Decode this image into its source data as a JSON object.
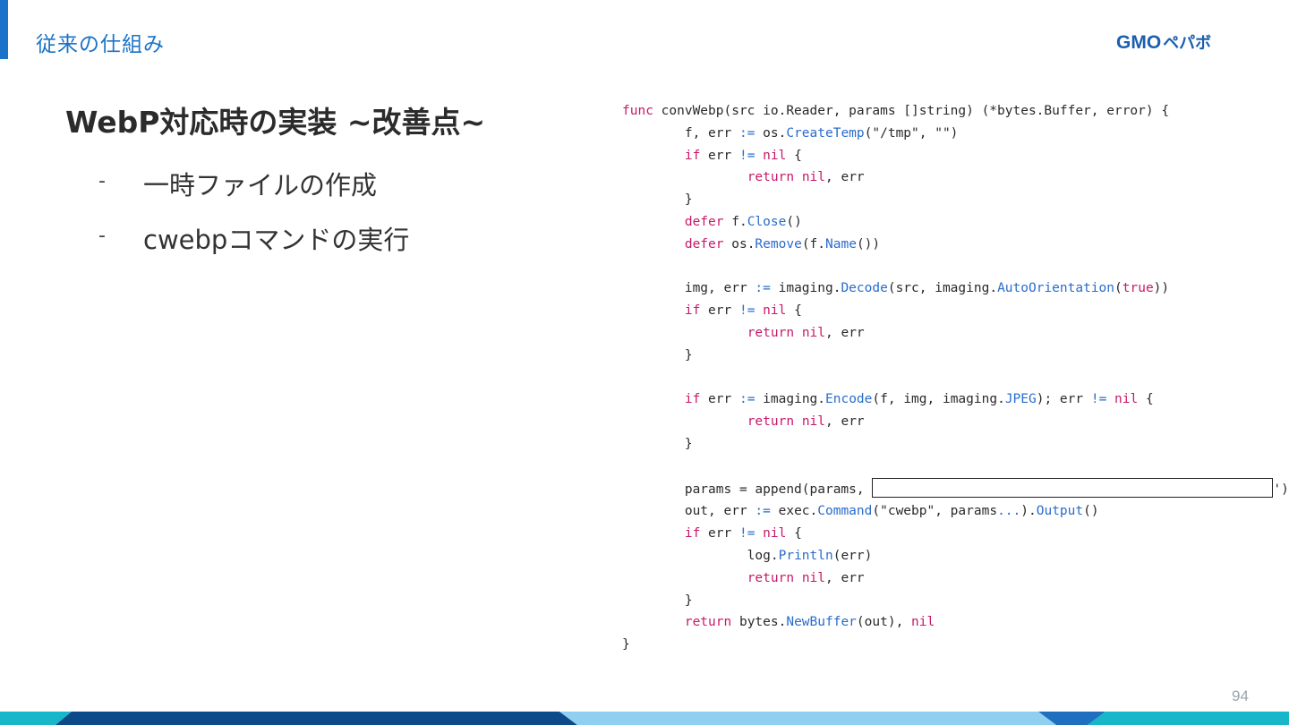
{
  "header": {
    "section_title": "従来の仕組み",
    "logo_text": "GMO",
    "logo_kana": "ペパボ"
  },
  "slide": {
    "heading": "WebP対応時の実装 ~改善点~",
    "bullets": [
      {
        "marker": "-",
        "text": "一時ファイルの作成"
      },
      {
        "marker": "-",
        "text": "cwebpコマンドの実行"
      }
    ]
  },
  "code": {
    "language": "go",
    "lines": [
      "func convWebp(src io.Reader, params []string) (*bytes.Buffer, error) {",
      "        f, err := os.CreateTemp(\"/tmp\", \"\")",
      "        if err != nil {",
      "                return nil, err",
      "        }",
      "        defer f.Close()",
      "        defer os.Remove(f.Name())",
      "",
      "        img, err := imaging.Decode(src, imaging.AutoOrientation(true))",
      "        if err != nil {",
      "                return nil, err",
      "        }",
      "",
      "        if err := imaging.Encode(f, img, imaging.JPEG); err != nil {",
      "                return nil, err",
      "        }",
      "",
      "        params = append(params, [REDACTED])",
      "        out, err := exec.Command(\"cwebp\", params...).Output()",
      "        if err != nil {",
      "                log.Println(err)",
      "                return nil, err",
      "        }",
      "        return bytes.NewBuffer(out), nil",
      "}"
    ]
  },
  "footer": {
    "page_number": "94",
    "colors": [
      "#17b7c9",
      "#0d4a8a",
      "#8fd0f0",
      "#1f6fc0",
      "#17b7c9"
    ]
  },
  "theme": {
    "accent": "#1a73c8",
    "keyword": "#c8186a",
    "function": "#2a6ccc"
  }
}
